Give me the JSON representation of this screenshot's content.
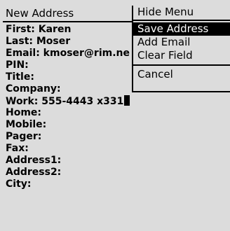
{
  "screen_title": "New Address",
  "fields": [
    {
      "label": "First:",
      "value": "Karen"
    },
    {
      "label": "Last:",
      "value": "Moser"
    },
    {
      "label": "Email:",
      "value": "kmoser@rim.ne"
    },
    {
      "label": "PIN:",
      "value": ""
    },
    {
      "label": "Title:",
      "value": ""
    },
    {
      "label": "Company:",
      "value": ""
    },
    {
      "label": "Work:",
      "value": "555-4443 x331"
    },
    {
      "label": "Home:",
      "value": ""
    },
    {
      "label": "Mobile:",
      "value": ""
    },
    {
      "label": "Pager:",
      "value": ""
    },
    {
      "label": "Fax:",
      "value": ""
    },
    {
      "label": "Address1:",
      "value": ""
    },
    {
      "label": "Address2:",
      "value": ""
    },
    {
      "label": "City:",
      "value": ""
    }
  ],
  "menu": {
    "items": [
      {
        "label": "Hide Menu"
      },
      {
        "label": "Save Address",
        "selected": true
      },
      {
        "label": "Add Email"
      },
      {
        "label": "Clear Field"
      },
      {
        "label": "Cancel"
      }
    ]
  },
  "colors": {
    "background": "#dcdcdc",
    "text": "#000000",
    "selection_bg": "#000000",
    "selection_text": "#ffffff"
  }
}
